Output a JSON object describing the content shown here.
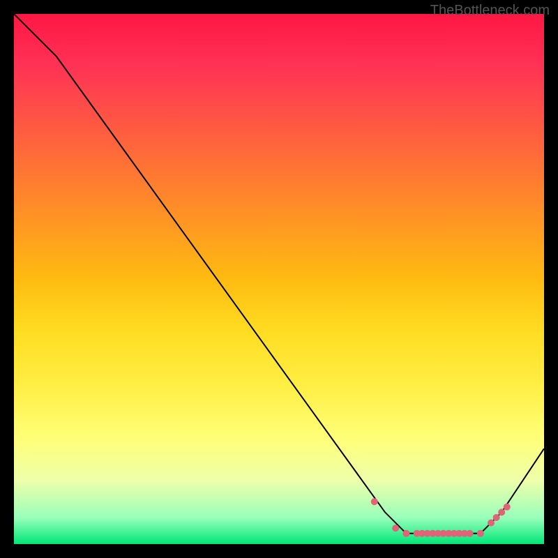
{
  "watermark": "TheBottleneck.com",
  "chart_data": {
    "type": "line",
    "title": "",
    "xlabel": "",
    "ylabel": "",
    "xlim": [
      0,
      100
    ],
    "ylim": [
      0,
      100
    ],
    "series": [
      {
        "name": "bottleneck-curve",
        "x": [
          0,
          8,
          70,
          74,
          88,
          92,
          100
        ],
        "y": [
          100,
          92,
          6,
          2,
          2,
          6,
          18
        ]
      }
    ],
    "markers": {
      "name": "highlighted-points",
      "color": "#e06377",
      "x": [
        68,
        72,
        74,
        76,
        77,
        78,
        79,
        80,
        81,
        82,
        83,
        84,
        85,
        86,
        88,
        90,
        91,
        92,
        93
      ],
      "y": [
        8,
        3,
        2,
        2,
        2,
        2,
        2,
        2,
        2,
        2,
        2,
        2,
        2,
        2,
        2,
        4,
        5,
        6,
        7
      ]
    },
    "gradient_stops": [
      {
        "pos": 0,
        "color": "#ff1744"
      },
      {
        "pos": 50,
        "color": "#ffdd22"
      },
      {
        "pos": 88,
        "color": "#eeffaa"
      },
      {
        "pos": 100,
        "color": "#00e676"
      }
    ]
  }
}
